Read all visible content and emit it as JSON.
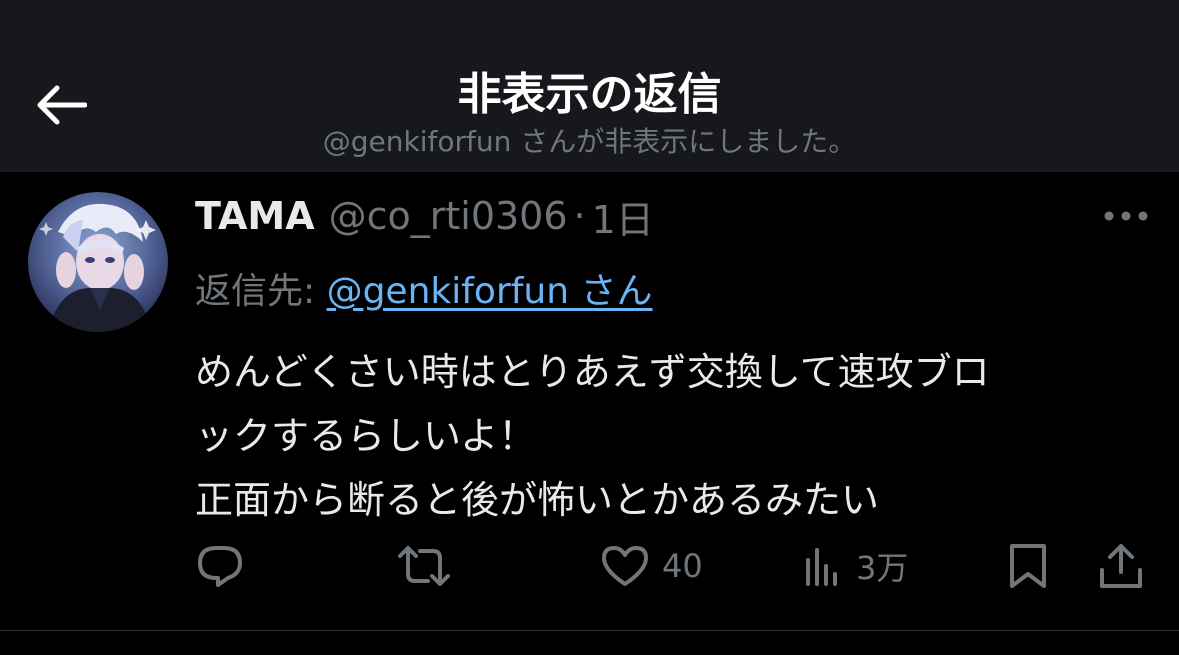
{
  "header": {
    "title": "非表示の返信",
    "subtitle": "@genkiforfun さんが非表示にしました。"
  },
  "tweet": {
    "author_name": "TAMA",
    "author_handle": "@co_rti0306",
    "separator": "·",
    "timestamp": "1日",
    "reply_label": "返信先: ",
    "reply_target": "@genkiforfun さん",
    "text_lines": [
      "めんどくさい時はとりあえず交換して速攻ブロ",
      "ックするらしいよ！",
      "正面から断ると後が怖いとかあるみたい"
    ]
  },
  "actions": {
    "reply": {
      "icon": "reply-icon",
      "count": ""
    },
    "retweet": {
      "icon": "retweet-icon",
      "count": ""
    },
    "like": {
      "icon": "heart-icon",
      "count": "40"
    },
    "views": {
      "icon": "analytics-icon",
      "count": "3万"
    },
    "bookmark": {
      "icon": "bookmark-icon"
    },
    "share": {
      "icon": "share-icon"
    }
  },
  "colors": {
    "background": "#000000",
    "header_background": "#16181c",
    "primary_text": "#e7e9ea",
    "secondary_text": "#71767b",
    "link": "#6ab4f5"
  }
}
